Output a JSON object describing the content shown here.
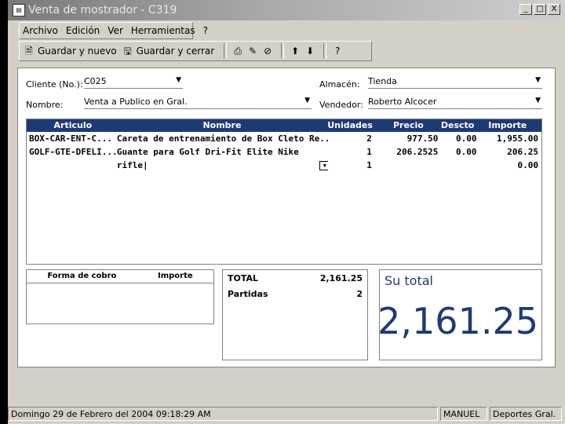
{
  "window": {
    "title": "Venta de mostrador - C319",
    "icon": "document-icon",
    "controls": [
      "_",
      "□",
      "X"
    ]
  },
  "menu": [
    "Archivo",
    "Edición",
    "Ver",
    "Herramientas",
    "?"
  ],
  "toolbar": {
    "save_new": "Guardar y nuevo",
    "save_close": "Guardar y cerrar"
  },
  "form": {
    "client_label": "Cliente (No.):",
    "client_value": "C025",
    "name_label": "Nombre:",
    "name_value": "Venta a Publico en Gral.",
    "warehouse_label": "Almacén:",
    "warehouse_value": "Tienda",
    "seller_label": "Vendedor:",
    "seller_value": "Roberto Alcocer"
  },
  "grid": {
    "headers": [
      "Articulo",
      "Nombre",
      "Unidades",
      "Precio",
      "Descto",
      "Importe"
    ],
    "rows": [
      [
        "BOX-CAR-ENT-C...",
        "Careta de entrenamiento de Box Cleto Re...",
        "2",
        "977.50",
        "0.00",
        "1,955.00"
      ],
      [
        "GOLF-GTE-DFELI...",
        "Guante para Golf Dri-Fit Elite Nike",
        "1",
        "206.2525",
        "0.00",
        "206.25"
      ],
      [
        "",
        "rifle",
        "1",
        "",
        "",
        "0.00"
      ]
    ]
  },
  "payment": {
    "col1": "Forma de cobro",
    "col2": "Importe"
  },
  "totals": {
    "total_label": "TOTAL",
    "total_value": "2,161.25",
    "items_label": "Partidas",
    "items_value": "2"
  },
  "su_total": {
    "label": "Su total",
    "value": "2,161.25"
  },
  "status": {
    "datetime": "Domingo 29 de Febrero del 2004 09:18:29 AM",
    "user": "MANUEL",
    "company": "Deportes Gral."
  }
}
